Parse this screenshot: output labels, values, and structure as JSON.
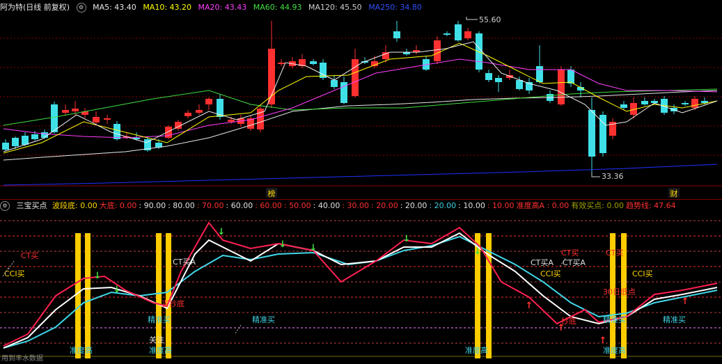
{
  "top_panel": {
    "title": "阿为特(日线 前复权)",
    "title_color": "#e8e8e8",
    "indicators": [
      {
        "label": "MA5: 43.40",
        "color": "#e8e8e8"
      },
      {
        "label": "MA10: 43.20",
        "color": "#ffff00"
      },
      {
        "label": "MA20: 43.43",
        "color": "#ff40ff"
      },
      {
        "label": "MA60: 44.93",
        "color": "#40e040"
      },
      {
        "label": "MA120: 45.50",
        "color": "#cfcfcf"
      },
      {
        "label": "MA250: 34.80",
        "color": "#3050ff"
      }
    ],
    "high_label": "55.60",
    "low_label": "33.36",
    "markers": [
      "榜",
      "财"
    ]
  },
  "bottom_panel": {
    "title": "三宝买点",
    "params": [
      {
        "label": "波段底: 0.00",
        "color": "#ffd700"
      },
      {
        "label": "大底: 0.00",
        "color": "#ff3030"
      },
      {
        "label": ": 90.00",
        "color": "#e0e0e0"
      },
      {
        "label": ": 80.00",
        "color": "#e0e0e0"
      },
      {
        "label": ": 70.00",
        "color": "#ff3030"
      },
      {
        "label": ": 60.00",
        "color": "#e0e0e0"
      },
      {
        "label": ": 60.00",
        "color": "#ff3030"
      },
      {
        "label": ": 50.00",
        "color": "#ff3030"
      },
      {
        "label": ": 40.00",
        "color": "#e0e0e0"
      },
      {
        "label": ": 30.00",
        "color": "#ff3030"
      },
      {
        "label": ": 20.00",
        "color": "#ff3030"
      },
      {
        "label": ": 20.00",
        "color": "#e0e0e0"
      },
      {
        "label": ": 20.00",
        "color": "#40d0e0"
      },
      {
        "label": ": 10.00",
        "color": "#e0e0e0"
      },
      {
        "label": ": 10.00",
        "color": "#ff3030"
      },
      {
        "label": "准度高A : 0.00",
        "color": "#ff3030"
      },
      {
        "label": "有效买点: 0.00",
        "color": "#a0a000"
      },
      {
        "label": "趋势线: 47.64",
        "color": "#ff3030"
      }
    ],
    "annotations": [
      {
        "text": "CT买",
        "color": "#ff3030"
      },
      {
        "text": "CCI买",
        "color": "#ffd700"
      },
      {
        "text": "CT买A",
        "color": "#e0e0e0"
      },
      {
        "text": "精准买",
        "color": "#40d0e0"
      },
      {
        "text": "精准买",
        "color": "#40d0e0"
      },
      {
        "text": "准度高",
        "color": "#40d0e0"
      },
      {
        "text": "准度高",
        "color": "#40d0e0"
      },
      {
        "text": "关注",
        "color": "#e0e0e0"
      },
      {
        "text": "准度高",
        "color": "#40d0e0"
      },
      {
        "text": "吉抄底",
        "color": "#ff3030"
      },
      {
        "text": "CT买A",
        "color": "#e0e0e0"
      },
      {
        "text": "CT买A",
        "color": "#e0e0e0"
      },
      {
        "text": "CT买",
        "color": "#ff3030"
      },
      {
        "text": "CT买",
        "color": "#ff3030"
      },
      {
        "text": "CCI买",
        "color": "#ffd700"
      },
      {
        "text": "CCI买",
        "color": "#ffd700"
      },
      {
        "text": "30日低点",
        "color": "#ff3030"
      },
      {
        "text": "精准买",
        "color": "#40d0e0"
      },
      {
        "text": "精准买",
        "color": "#40d0e0"
      },
      {
        "text": "抄底",
        "color": "#ff3030"
      },
      {
        "text": "准度高",
        "color": "#40d0e0"
      },
      {
        "text": "用到丰水数据",
        "color": "#8a8a8a"
      }
    ]
  },
  "colors": {
    "up": "#ff3030",
    "down": "#40e0e8",
    "grid": "#8b0000",
    "bar": "#ffcc00"
  }
}
